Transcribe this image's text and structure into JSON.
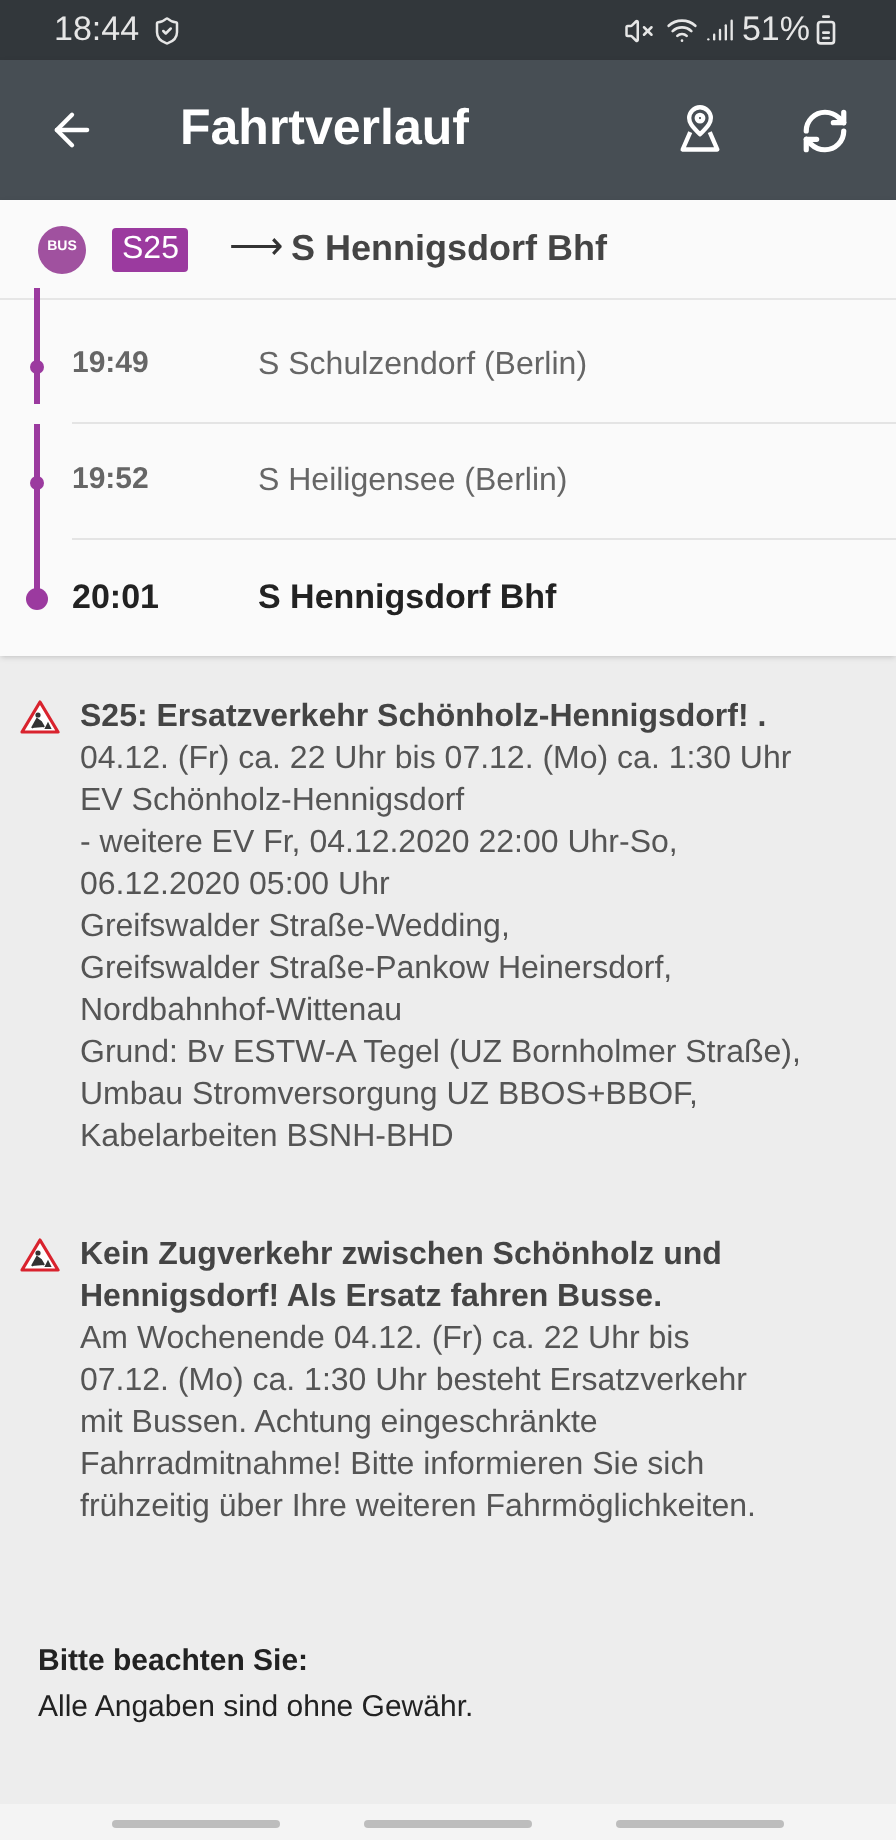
{
  "status_bar": {
    "time": "18:44",
    "battery": "51%"
  },
  "toolbar": {
    "title": "Fahrtverlauf"
  },
  "route": {
    "mode": "BUS",
    "line": "S25",
    "arrow": "⟶",
    "destination": "S Hennigsdorf Bhf"
  },
  "stops": [
    {
      "time": "19:49",
      "name": "S Schulzendorf (Berlin)",
      "kind": "stop"
    },
    {
      "time": "19:52",
      "name": "S Heiligensee (Berlin)",
      "kind": "stop"
    },
    {
      "time": "20:01",
      "name": "S Hennigsdorf Bhf",
      "kind": "destination"
    }
  ],
  "messages": [
    {
      "title": "S25: Ersatzverkehr Schönholz-Hennigsdorf! .",
      "body": "04.12. (Fr) ca. 22 Uhr bis 07.12. (Mo) ca. 1:30 Uhr\nEV Schönholz-Hennigsdorf\n- weitere EV Fr, 04.12.2020 22:00 Uhr-So,\n06.12.2020 05:00 Uhr\nGreifswalder Straße-Wedding,\nGreifswalder Straße-Pankow Heinersdorf,\nNordbahnhof-Wittenau\nGrund: Bv ESTW-A Tegel (UZ Bornholmer Straße),\nUmbau Stromversorgung UZ BBOS+BBOF,\nKabelarbeiten BSNH-BHD"
    },
    {
      "title": "Kein Zugverkehr zwischen Schönholz und\nHennigsdorf! Als Ersatz fahren Busse.",
      "body": "Am Wochenende 04.12. (Fr) ca. 22 Uhr bis\n07.12. (Mo) ca. 1:30 Uhr besteht Ersatzverkehr\nmit Bussen. Achtung eingeschränkte\nFahrradmitnahme! Bitte informieren Sie sich\nfrühzeitig über Ihre weiteren Fahrmöglichkeiten."
    }
  ],
  "notice": {
    "title": "Bitte beachten Sie:",
    "text": "Alle Angaben sind ohne Gewähr."
  }
}
